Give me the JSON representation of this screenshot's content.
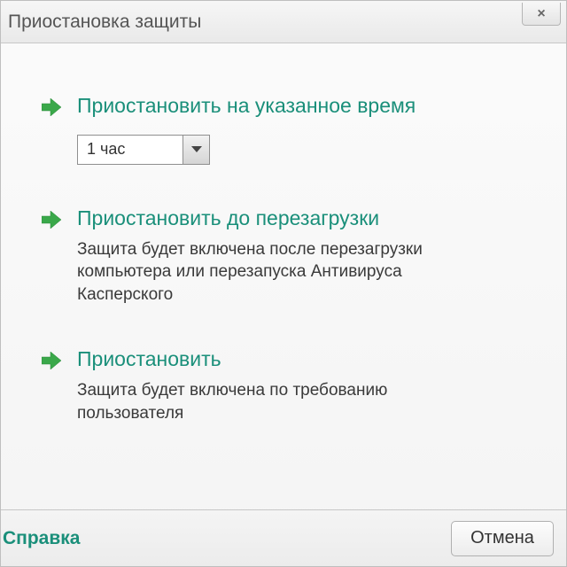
{
  "window": {
    "title": "Приостановка защиты",
    "close_label": "×"
  },
  "options": {
    "time": {
      "title": "Приостановить на указанное время",
      "selected": "1 час"
    },
    "reboot": {
      "title": "Приостановить до перезагрузки",
      "desc": "Защита будет включена после перезагрузки компьютера или перезапуска Антивируса Касперского"
    },
    "manual": {
      "title": "Приостановить",
      "desc": "Защита будет включена по требованию пользователя"
    }
  },
  "footer": {
    "help": "Справка",
    "cancel": "Отмена"
  },
  "colors": {
    "accent": "#1a8f7a",
    "arrow": "#3aa84a"
  }
}
